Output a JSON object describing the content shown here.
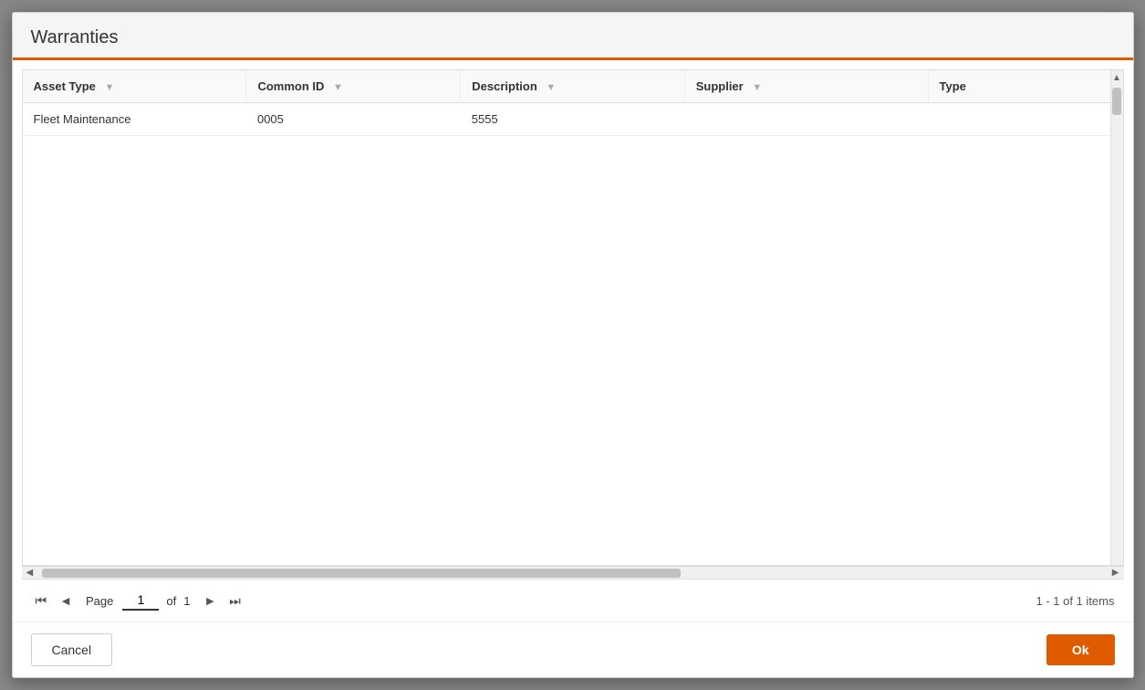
{
  "dialog": {
    "title": "Warranties",
    "accentColor": "#e05a00"
  },
  "table": {
    "columns": [
      {
        "key": "asset_type",
        "label": "Asset Type",
        "has_filter": true
      },
      {
        "key": "common_id",
        "label": "Common ID",
        "has_filter": true
      },
      {
        "key": "description",
        "label": "Description",
        "has_filter": true
      },
      {
        "key": "supplier",
        "label": "Supplier",
        "has_filter": true
      },
      {
        "key": "type",
        "label": "Type",
        "has_filter": false
      }
    ],
    "rows": [
      {
        "asset_type": "Fleet Maintenance",
        "common_id": "0005",
        "description": "5555",
        "supplier": "",
        "type": ""
      }
    ]
  },
  "pagination": {
    "page_label": "Page",
    "current_page": "1",
    "of_label": "of",
    "total_pages": "1",
    "items_info": "1 - 1 of 1 items"
  },
  "footer": {
    "cancel_label": "Cancel",
    "ok_label": "Ok"
  }
}
